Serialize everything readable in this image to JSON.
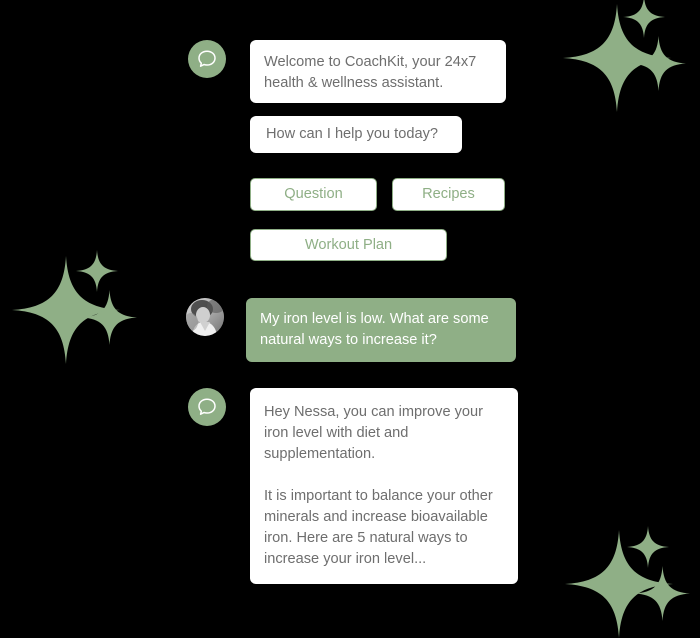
{
  "theme": {
    "background": "#000000",
    "accent_green": "#8faf86",
    "bubble_bg": "#ffffff",
    "bubble_text": "#6e6e6e",
    "user_bubble_text": "#ffffff",
    "sparkle_color": "#8faf86"
  },
  "conversation": {
    "messages": [
      {
        "id": "welcome",
        "sender": "assistant",
        "avatar_icon": "chat-bubble-icon",
        "text": "Welcome to CoachKit, your 24x7 health & wellness assistant."
      },
      {
        "id": "help",
        "sender": "assistant",
        "text": "How can I help you today?"
      },
      {
        "id": "user-question",
        "sender": "user",
        "avatar_icon": "user-photo-avatar",
        "text": "My iron level is low. What are some natural ways to increase it?"
      },
      {
        "id": "reply",
        "sender": "assistant",
        "avatar_icon": "chat-bubble-icon",
        "text": "Hey Nessa, you can improve your iron level with diet and supplementation.\n\nIt is important to balance your other minerals and increase bioavailable iron. Here are 5 natural ways to increase your iron level..."
      }
    ],
    "quick_replies": [
      {
        "id": "question",
        "label": "Question"
      },
      {
        "id": "recipes",
        "label": "Recipes"
      },
      {
        "id": "workout",
        "label": "Workout Plan"
      }
    ]
  },
  "decorations": {
    "sparkle_clusters": [
      {
        "name": "top-right-sparkles"
      },
      {
        "name": "mid-left-sparkles"
      },
      {
        "name": "bottom-right-sparkles"
      }
    ]
  }
}
